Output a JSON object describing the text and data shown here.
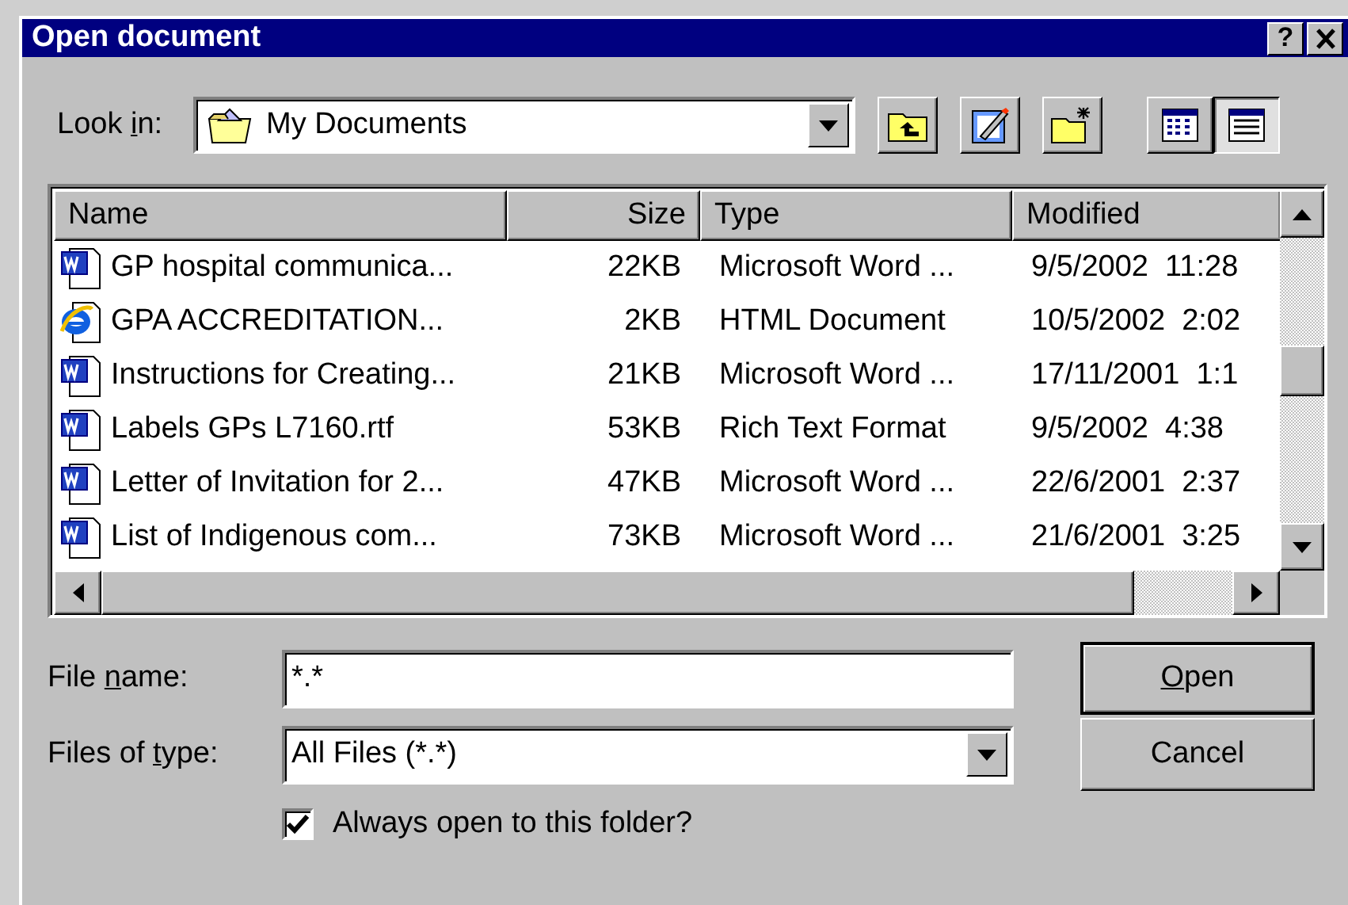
{
  "window": {
    "title": "Open document",
    "help": "?"
  },
  "look_in": {
    "label_parts": [
      {
        "text": "Look "
      },
      {
        "text": "i",
        "underline": true
      },
      {
        "text": "n:"
      }
    ],
    "value": "My Documents"
  },
  "toolbar": {
    "buttons": [
      {
        "kind": "up-folder"
      },
      {
        "kind": "favorites"
      },
      {
        "kind": "new-folder"
      }
    ],
    "views": [
      {
        "kind": "list",
        "selected": false
      },
      {
        "kind": "details",
        "selected": true
      }
    ]
  },
  "file_list": {
    "columns": [
      "Name",
      "Size",
      "Type",
      "Modified"
    ],
    "rows": [
      {
        "kind": "word",
        "name": "GP hospital communica...",
        "size": "22KB",
        "type": "Microsoft Word ...",
        "modified": "9/5/2002  11:28"
      },
      {
        "kind": "web",
        "name": "GPA ACCREDITATION...",
        "size": "2KB",
        "type": "HTML Document",
        "modified": "10/5/2002  2:02"
      },
      {
        "kind": "word",
        "name": "Instructions for Creating...",
        "size": "21KB",
        "type": "Microsoft Word ...",
        "modified": "17/11/2001  1:1"
      },
      {
        "kind": "word",
        "name": "Labels GPs L7160.rtf",
        "size": "53KB",
        "type": "Rich Text Format",
        "modified": "9/5/2002  4:38"
      },
      {
        "kind": "word",
        "name": "Letter of Invitation for 2...",
        "size": "47KB",
        "type": "Microsoft Word ...",
        "modified": "22/6/2001  2:37"
      },
      {
        "kind": "word",
        "name": "List of Indigenous com...",
        "size": "73KB",
        "type": "Microsoft Word ...",
        "modified": "21/6/2001  3:25"
      }
    ]
  },
  "file_name": {
    "label_parts": [
      {
        "text": "File "
      },
      {
        "text": "n",
        "underline": true
      },
      {
        "text": "ame:"
      }
    ],
    "value": "*.*"
  },
  "files_of_type": {
    "label_parts": [
      {
        "text": "Files of "
      },
      {
        "text": "t",
        "underline": true
      },
      {
        "text": "ype:"
      }
    ],
    "value": "All Files (*.*)"
  },
  "always_open": {
    "label": "Always open to this folder?",
    "checked": true
  },
  "buttons": [
    {
      "kind": "default",
      "label_parts": [
        {
          "text": "O",
          "underline": true
        },
        {
          "text": "pen"
        }
      ]
    },
    {
      "kind": "normal",
      "label_parts": [
        {
          "text": "Cancel"
        }
      ]
    }
  ]
}
